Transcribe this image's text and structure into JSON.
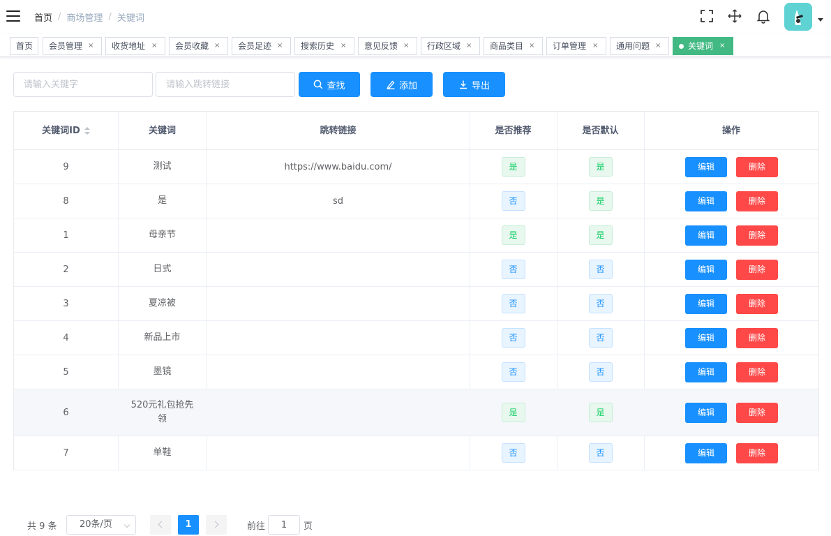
{
  "breadcrumb": [
    "首页",
    "商场管理",
    "关键词"
  ],
  "tags": [
    {
      "label": "首页",
      "closable": false,
      "active": false
    },
    {
      "label": "会员管理",
      "closable": true,
      "active": false
    },
    {
      "label": "收货地址",
      "closable": true,
      "active": false
    },
    {
      "label": "会员收藏",
      "closable": true,
      "active": false
    },
    {
      "label": "会员足迹",
      "closable": true,
      "active": false
    },
    {
      "label": "搜索历史",
      "closable": true,
      "active": false
    },
    {
      "label": "意见反馈",
      "closable": true,
      "active": false
    },
    {
      "label": "行政区域",
      "closable": true,
      "active": false
    },
    {
      "label": "商品类目",
      "closable": true,
      "active": false
    },
    {
      "label": "订单管理",
      "closable": true,
      "active": false
    },
    {
      "label": "通用问题",
      "closable": true,
      "active": false
    },
    {
      "label": "关键词",
      "closable": true,
      "active": true
    }
  ],
  "tag_close_symbol": "×",
  "search": {
    "keyword_placeholder": "请输入关键字",
    "url_placeholder": "请输入跳转链接",
    "search_label": "查找",
    "add_label": "添加",
    "export_label": "导出"
  },
  "table": {
    "headers": [
      "关键词ID",
      "关键词",
      "跳转链接",
      "是否推荐",
      "是否默认",
      "操作"
    ],
    "rows": [
      {
        "id": "9",
        "keyword": "测试",
        "url": "https://www.baidu.com/",
        "recommend": "是",
        "is_default": "是"
      },
      {
        "id": "8",
        "keyword": "是",
        "url": "sd",
        "recommend": "否",
        "is_default": "是"
      },
      {
        "id": "1",
        "keyword": "母亲节",
        "url": "",
        "recommend": "是",
        "is_default": "是"
      },
      {
        "id": "2",
        "keyword": "日式",
        "url": "",
        "recommend": "否",
        "is_default": "否"
      },
      {
        "id": "3",
        "keyword": "夏凉被",
        "url": "",
        "recommend": "否",
        "is_default": "否"
      },
      {
        "id": "4",
        "keyword": "新品上市",
        "url": "",
        "recommend": "否",
        "is_default": "否"
      },
      {
        "id": "5",
        "keyword": "墨镜",
        "url": "",
        "recommend": "否",
        "is_default": "否"
      },
      {
        "id": "6",
        "keyword": "520元礼包抢先领",
        "url": "",
        "recommend": "是",
        "is_default": "是"
      },
      {
        "id": "7",
        "keyword": "单鞋",
        "url": "",
        "recommend": "否",
        "is_default": "否"
      }
    ],
    "edit_label": "编辑",
    "delete_label": "删除"
  },
  "pagination": {
    "total_text": "共 9 条",
    "page_size": "20条/页",
    "current_page": "1",
    "goto_label": "前往",
    "goto_value": "1",
    "page_suffix": "页"
  },
  "colors": {
    "primary": "#1890ff",
    "danger": "#ff4949",
    "success": "#13ce66",
    "active_tag": "#42b983"
  }
}
